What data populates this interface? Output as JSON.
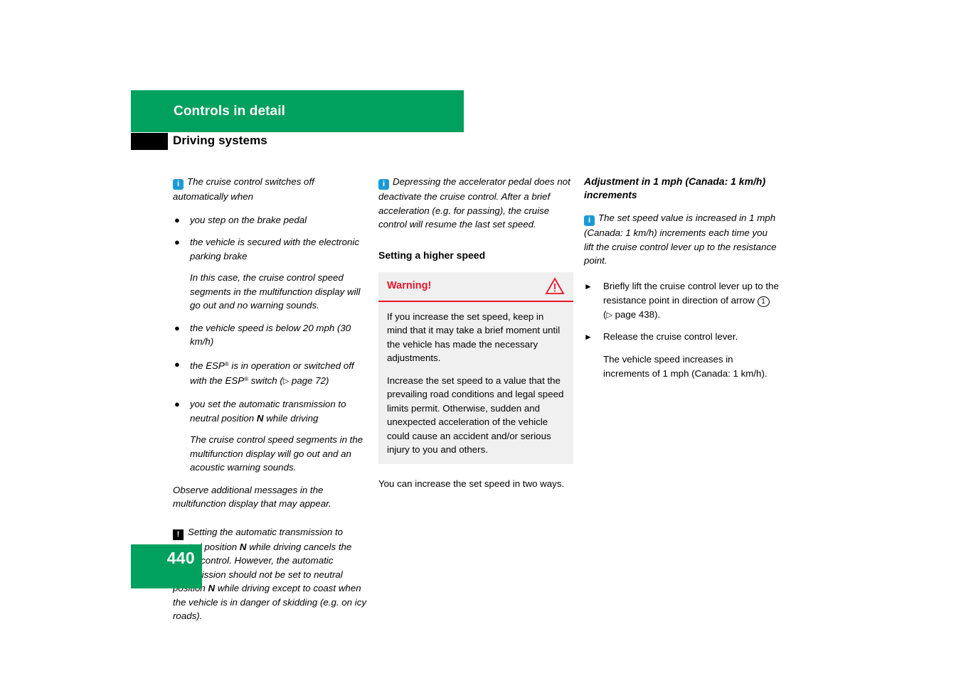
{
  "header": {
    "banner_title": "Controls in detail",
    "section_title": "Driving systems"
  },
  "footer": {
    "page_number": "440"
  },
  "colors": {
    "brand_green": "#00a05e",
    "info_blue": "#1b9ad6",
    "warning_red": "#e8152a",
    "warning_bg": "#f0f0f0",
    "tab_black": "#000000"
  },
  "column_1": {
    "info_note": {
      "icon": "info-icon",
      "text": "The cruise control switches off automatically when"
    },
    "bullets": [
      {
        "icon": "bullet-dot-icon",
        "text": "you step on the brake pedal"
      },
      {
        "icon": "bullet-dot-icon",
        "text": "the vehicle is secured with the electronic parking brake"
      },
      {
        "icon": "bullet-dot-icon",
        "text": "the vehicle speed is below 20 mph (30 km/h)"
      },
      {
        "icon": "bullet-dot-icon",
        "text_before": "the ",
        "esp_1": "ESP",
        "reg_1": "®",
        "text_mid": " is in operation or switched off with the ",
        "esp_2": "ESP",
        "reg_2": "®",
        "text_after": " switch (",
        "ref_icon": "▷",
        "ref_text": " page 72)"
      },
      {
        "icon": "bullet-dot-icon",
        "text_before": "you set the automatic transmission to neutral position ",
        "bold": "N",
        "text_after": " while driving"
      }
    ],
    "sub_para_1": "In this case, the cruise control speed segments in the multifunction display will go out and no warning sounds.",
    "sub_para_2": "The cruise control speed segments in the multifunction display will go out and an acoustic warning sounds.",
    "closing_para": "Observe additional messages in the multifunction display that may appear.",
    "caution_note": {
      "icon": "caution-icon",
      "part_1": "Setting the automatic transmission to neutral position ",
      "bold_1": "N",
      "part_2": " while driving cancels the cruise control. However, the automatic transmission should not be set to neutral position ",
      "bold_2": "N",
      "part_3": " while driving except to coast when the vehicle is in danger of skidding (e.g. on icy roads)."
    }
  },
  "column_2": {
    "info_note": {
      "icon": "info-icon",
      "text": "Depressing the accelerator pedal does not deactivate the cruise control. After a brief acceleration (e.g. for passing), the cruise control will resume the last set speed."
    },
    "heading": "Setting a higher speed",
    "warning_box": {
      "title": "Warning!",
      "icon": "warning-triangle-icon",
      "paragraphs": [
        "If you increase the set speed, keep in mind that it may take a brief moment until the vehicle has made the necessary adjustments.",
        "Increase the set speed to a value that the prevailing road conditions and legal speed limits permit. Otherwise, sudden and unexpected acceleration of the vehicle could cause an accident and/or serious injury to you and others."
      ]
    },
    "closing_para": "You can increase the set speed in two ways."
  },
  "column_3": {
    "heading": "Adjustment in 1 mph (Canada: 1 km/h) increments",
    "info_note": {
      "icon": "info-icon",
      "text": "The set speed value is increased in 1 mph (Canada: 1 km/h) increments each time you lift the cruise control lever up to the resistance point."
    },
    "steps": [
      {
        "icon": "triangle-bullet-icon",
        "text_before": "Briefly lift the cruise control lever up to the resistance point in direction of arrow ",
        "circled": "1",
        "text_mid": " (",
        "ref_icon": "▷",
        "text_after": " page 438)."
      },
      {
        "icon": "triangle-bullet-icon",
        "text_before": "Release the cruise control lever."
      }
    ],
    "step_note": "The vehicle speed increases in increments of 1 mph (Canada: 1 km/h)."
  }
}
